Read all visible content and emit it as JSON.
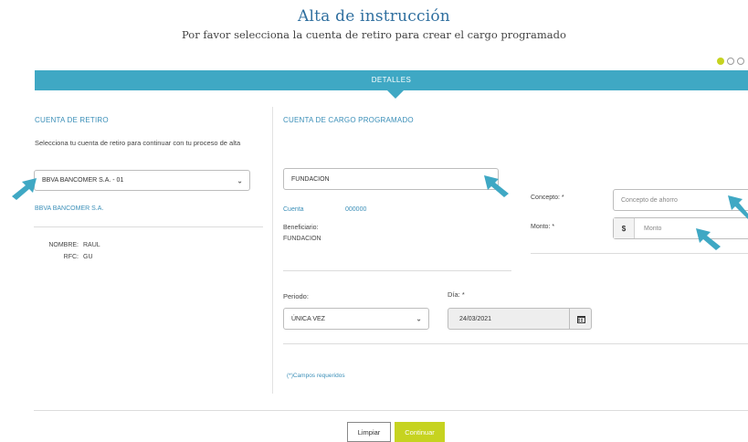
{
  "header": {
    "title": "Alta de instrucción",
    "subtitle": "Por favor selecciona la cuenta de retiro para crear el cargo programado"
  },
  "steps": {
    "current": 1
  },
  "tab_bar": {
    "label": "DETALLES"
  },
  "retiro": {
    "section_title": "CUENTA DE RETIRO",
    "instruction": "Selecciona tu cuenta de retiro para continuar con tu proceso de alta",
    "selected_account": "BBVA BANCOMER S.A. - 01",
    "bank_name": "BBVA BANCOMER S.A.",
    "nombre_label": "NOMBRE:",
    "nombre_value": "RAUL",
    "rfc_label": "RFC:",
    "rfc_value": "GU"
  },
  "cargo": {
    "section_title": "CUENTA DE CARGO PROGRAMADO",
    "selected": "FUNDACION",
    "cuenta_label": "Cuenta",
    "cuenta_value": "000000",
    "beneficiario_label": "Beneficiario:",
    "beneficiario_value": "FUNDACION"
  },
  "concepto": {
    "label": "Concepto: *",
    "placeholder": "Concepto de ahorro"
  },
  "monto": {
    "label": "Monto: *",
    "currency": "$",
    "placeholder": "Monto"
  },
  "periodo": {
    "label": "Periodo:",
    "value": "ÚNICA VEZ"
  },
  "dia": {
    "label": "Día: *",
    "value": "24/03/2021"
  },
  "required_note": "(*)Campos requeridos",
  "buttons": {
    "clear": "Limpiar",
    "continue": "Continuar"
  },
  "colors": {
    "accent": "#3fa8c4",
    "link": "#3b8fb8",
    "brand_green": "#c6d320",
    "title": "#2f6f9f"
  },
  "icons": [
    "calendar-icon",
    "chevron-down-icon",
    "pointer-arrow-icon"
  ]
}
